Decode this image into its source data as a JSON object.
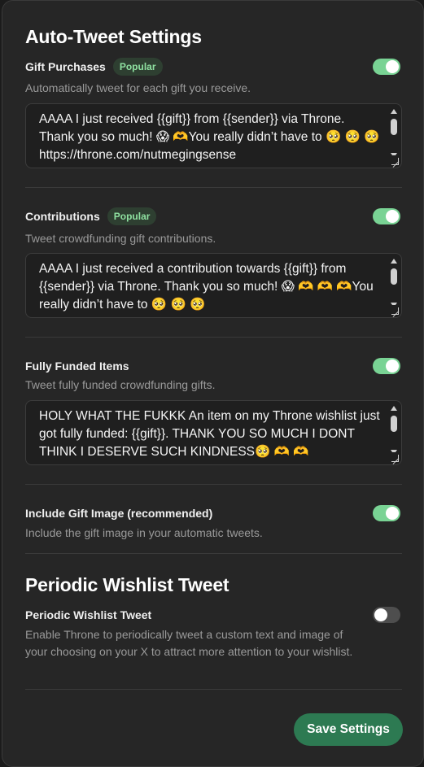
{
  "auto_tweet": {
    "title": "Auto-Tweet Settings",
    "gift_purchases": {
      "label": "Gift Purchases",
      "badge": "Popular",
      "description": "Automatically tweet for each gift you receive.",
      "enabled": true,
      "template": "AAAA I just received {{gift}} from {{sender}} via Throne. Thank you so much! 😱 🫶You really didn’t have to 🥺 🥺 🥺https://throne.com/nutmegingsense"
    },
    "contributions": {
      "label": "Contributions",
      "badge": "Popular",
      "description": "Tweet crowdfunding gift contributions.",
      "enabled": true,
      "template": "AAAA I just received a contribution towards {{gift}} from {{sender}} via Throne. Thank you so much! 😱 🫶 🫶 🫶You really didn’t have to 🥺 🥺 🥺"
    },
    "fully_funded": {
      "label": "Fully Funded Items",
      "description": "Tweet fully funded crowdfunding gifts.",
      "enabled": true,
      "template": "HOLY WHAT THE FUKKK An item on my Throne wishlist just got fully funded: {{gift}}. THANK YOU SO MUCH I DONT THINK I DESERVE SUCH KINDNESS🥺 🫶 🫶"
    },
    "include_image": {
      "label": "Include Gift Image (recommended)",
      "description": "Include the gift image in your automatic tweets.",
      "enabled": true
    }
  },
  "periodic": {
    "title": "Periodic Wishlist Tweet",
    "label": "Periodic Wishlist Tweet",
    "description": "Enable Throne to periodically tweet a custom text and image of your choosing on your X to attract more attention to your wishlist.",
    "enabled": false
  },
  "save_label": "Save Settings",
  "colors": {
    "toggle_on": "#79d394",
    "toggle_off": "#4e4e4e",
    "save_button": "#2d7a52",
    "badge_bg": "#2e3f31",
    "badge_text": "#8ee0a0"
  }
}
